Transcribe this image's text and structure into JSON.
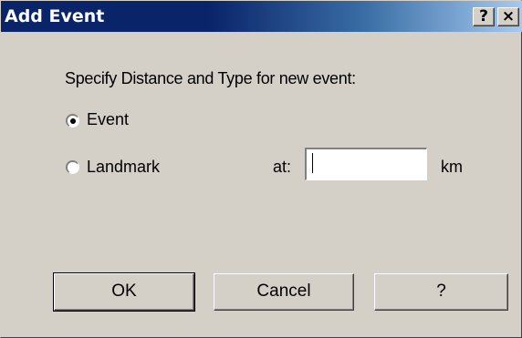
{
  "window": {
    "title": "Add Event",
    "help_glyph": "?",
    "close_glyph": "×"
  },
  "form": {
    "prompt": "Specify Distance and Type for new event:",
    "options": [
      {
        "label": "Event",
        "selected": true
      },
      {
        "label": "Landmark",
        "selected": false
      }
    ],
    "distance_label": "at:",
    "distance_value": "",
    "distance_unit": "km"
  },
  "buttons": {
    "ok": "OK",
    "cancel": "Cancel",
    "help": "?"
  },
  "colors": {
    "titlebar_start": "#0a246a",
    "titlebar_end": "#a6caf0",
    "face": "#d4d0c8"
  }
}
